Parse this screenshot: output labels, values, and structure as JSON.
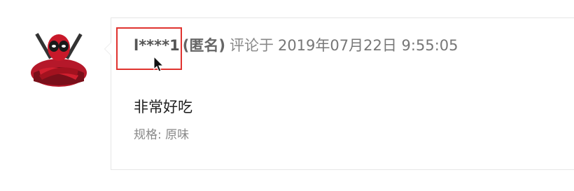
{
  "comment": {
    "username": "l****1",
    "anonymous_tag": "(匿名)",
    "comment_label": "评论于",
    "date": "2019年07月22日",
    "time": "9:55:05",
    "text": "非常好吃",
    "spec_label": "规格:",
    "spec_value": "原味"
  },
  "colors": {
    "highlight": "#e0332f",
    "avatar_red": "#c8192a"
  },
  "icons": {
    "avatar": "deadpool-avatar-icon",
    "cursor": "mouse-pointer-icon"
  }
}
